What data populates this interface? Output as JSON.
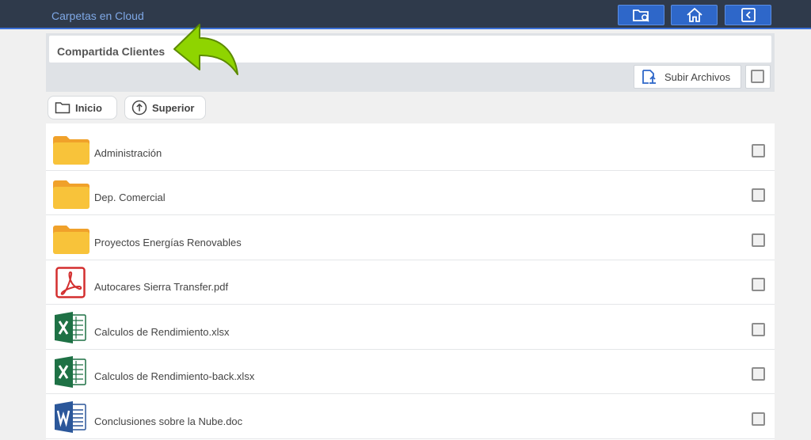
{
  "header": {
    "title": "Carpetas en Cloud",
    "buttons": [
      {
        "icon": "folder-search-icon"
      },
      {
        "icon": "home-icon"
      },
      {
        "icon": "back-icon"
      }
    ]
  },
  "breadcrumb": {
    "current_folder": "Compartida Clientes"
  },
  "toolbar": {
    "upload_label": "Subir Archivos",
    "upload_icon": "upload-icon",
    "select_all_checked": false
  },
  "nav": {
    "home_label": "Inicio",
    "up_label": "Superior"
  },
  "files": [
    {
      "name": "Administración",
      "type": "folder",
      "icon": "folder-icon",
      "checked": false
    },
    {
      "name": "Dep. Comercial",
      "type": "folder",
      "icon": "folder-icon",
      "checked": false
    },
    {
      "name": "Proyectos Energías Renovables",
      "type": "folder",
      "icon": "folder-icon",
      "checked": false
    },
    {
      "name": "Autocares Sierra Transfer.pdf",
      "type": "pdf",
      "icon": "pdf-icon",
      "checked": false
    },
    {
      "name": "Calculos de Rendimiento.xlsx",
      "type": "xlsx",
      "icon": "excel-icon",
      "checked": false
    },
    {
      "name": "Calculos de Rendimiento-back.xlsx",
      "type": "xlsx",
      "icon": "excel-icon",
      "checked": false
    },
    {
      "name": "Conclusiones sobre la Nube.doc",
      "type": "doc",
      "icon": "word-icon",
      "checked": false
    }
  ],
  "colors": {
    "header_bg": "#2f3a4b",
    "header_button": "#2e67c9",
    "header_title": "#7fa8e6",
    "folder": "#f8c33a",
    "pdf": "#d32f2f",
    "excel": "#1e7145",
    "word": "#2b579a",
    "annotation_arrow": "#8fd400"
  }
}
